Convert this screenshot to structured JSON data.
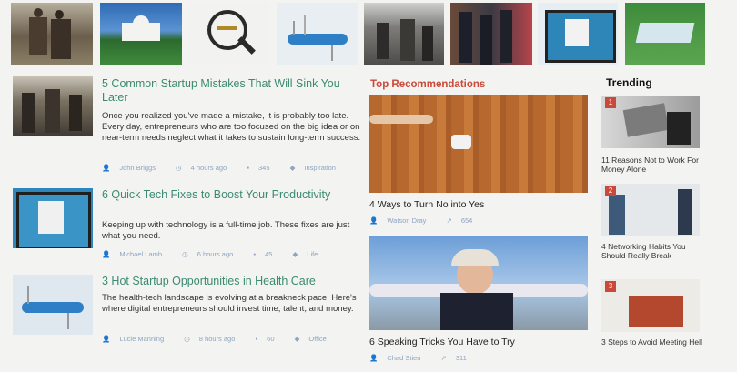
{
  "articles": [
    {
      "title": "5 Common Startup Mistakes That Will Sink You Later",
      "excerpt": "Once you realized you've made a mistake, it is probably too late. Every day, entrepreneurs who are too focused on the big idea or on near-term needs neglect what it takes to sustain long-term success.",
      "author": "John Briggs",
      "time": "4 hours ago",
      "comments": "345",
      "category": "Inspiration"
    },
    {
      "title": "6 Quick Tech Fixes to Boost Your Productivity",
      "excerpt": "Keeping up with technology is a full-time job. These fixes are just what you need.",
      "author": "Michael Lamb",
      "time": "6 hours ago",
      "comments": "45",
      "category": "Life"
    },
    {
      "title": "3 Hot Startup Opportunities in Health Care",
      "excerpt": "The health-tech landscape is evolving at a breakneck pace. Here's where digital entrepreneurs should invest time, talent, and money.",
      "author": "Lucie Manning",
      "time": "8 hours ago",
      "comments": "60",
      "category": "Office"
    }
  ],
  "recommendations": {
    "heading": "Top Recommendations",
    "items": [
      {
        "title": "4 Ways to Turn No into Yes",
        "author": "Watson Dray",
        "shares": "654"
      },
      {
        "title": "6 Speaking Tricks You Have to Try",
        "author": "Chad Stien",
        "shares": "311"
      }
    ]
  },
  "trending": {
    "heading": "Trending",
    "items": [
      {
        "num": "1",
        "title": "11 Reasons Not to Work For Money Alone"
      },
      {
        "num": "2",
        "title": "4 Networking Habits You Should Really Break"
      },
      {
        "num": "3",
        "title": "3 Steps to Avoid Meeting Hell"
      }
    ]
  },
  "colors": {
    "title_green": "#3b8a73",
    "heading_red": "#c94a3a",
    "meta_blue": "#8fa3c2"
  },
  "icons": [
    "user-icon",
    "clock-icon",
    "comment-icon",
    "tag-icon",
    "share-icon"
  ]
}
